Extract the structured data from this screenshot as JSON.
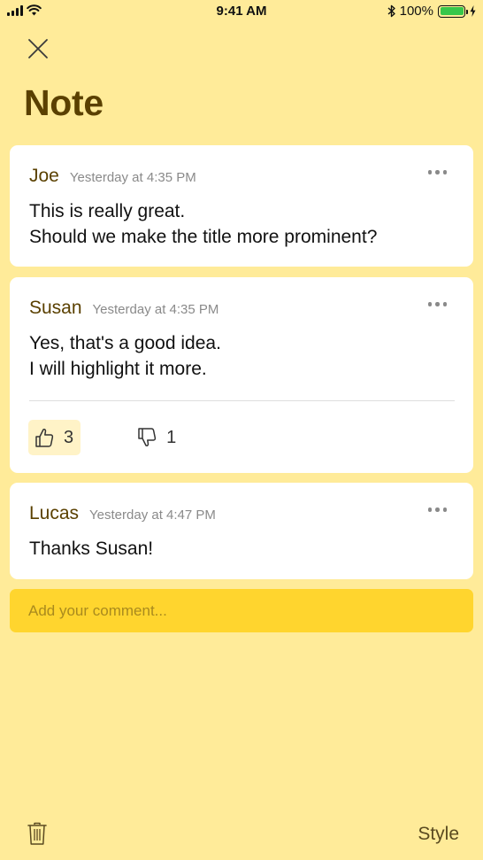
{
  "status_bar": {
    "time": "9:41 AM",
    "battery_percent": "100%",
    "battery_level": 1.0,
    "battery_color": "#37C74A",
    "icons": [
      "signal-icon",
      "wifi-icon",
      "bluetooth-icon",
      "battery-icon",
      "charging-icon"
    ]
  },
  "header": {
    "title": "Note",
    "close_icon": "close-icon"
  },
  "comments": [
    {
      "author": "Joe",
      "timestamp": "Yesterday at 4:35 PM",
      "lines": [
        "This is really great.",
        "Should we make the title more prominent?"
      ]
    },
    {
      "author": "Susan",
      "timestamp": "Yesterday at 4:35 PM",
      "lines": [
        "Yes, that's a good idea.",
        "I will highlight it more."
      ],
      "likes": "3",
      "dislikes": "1",
      "liked_by_me": true
    },
    {
      "author": "Lucas",
      "timestamp": "Yesterday at 4:47 PM",
      "lines": [
        "Thanks Susan!"
      ]
    }
  ],
  "composer": {
    "placeholder": "Add your comment...",
    "value": ""
  },
  "footer": {
    "style_label": "Style",
    "trash_icon": "trash-icon"
  },
  "colors": {
    "background": "#FFEB99",
    "accent": "#FFD52E",
    "title": "#5A4000"
  }
}
